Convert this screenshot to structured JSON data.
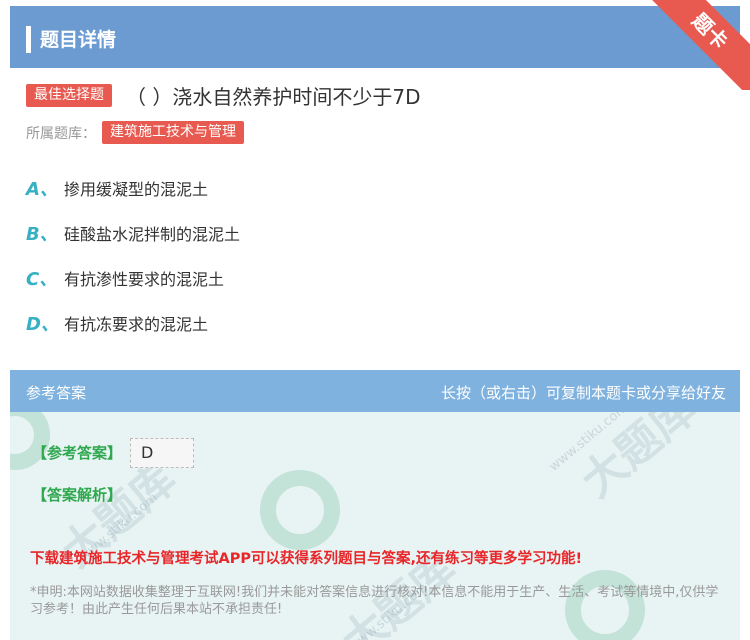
{
  "header": {
    "title": "题目详情"
  },
  "corner_badge": "题卡",
  "question": {
    "tag": "最佳选择题",
    "text": "（  ）浇水自然养护时间不少于7D",
    "bank_label": "所属题库：",
    "bank_name": "建筑施工技术与管理"
  },
  "options": [
    {
      "letter": "A、",
      "text": "掺用缓凝型的混泥土"
    },
    {
      "letter": "B、",
      "text": "硅酸盐水泥拌制的混泥土"
    },
    {
      "letter": "C、",
      "text": "有抗渗性要求的混泥土"
    },
    {
      "letter": "D、",
      "text": "有抗冻要求的混泥土"
    }
  ],
  "answer": {
    "head_left": "参考答案",
    "head_right": "长按（或右击）可复制本题卡或分享给好友",
    "ref_label": "【参考答案】",
    "ref_value": "D",
    "analysis_label": "【答案解析】",
    "promo": "下载建筑施工技术与管理考试APP可以获得系列题目与答案,还有练习等更多学习功能!",
    "disclaimer": "*申明:本网站数据收集整理于互联网!我们并未能对答案信息进行核对!本信息不能用于生产、生活、考试等情境中,仅供学习参考！由此产生任何后果本站不承担责任!"
  },
  "colors": {
    "header_bg": "#6b9bd0",
    "accent_red": "#e8594f",
    "option_letter": "#36b0c2",
    "answer_green": "#2fa84f",
    "promo_red": "#e8262a"
  }
}
